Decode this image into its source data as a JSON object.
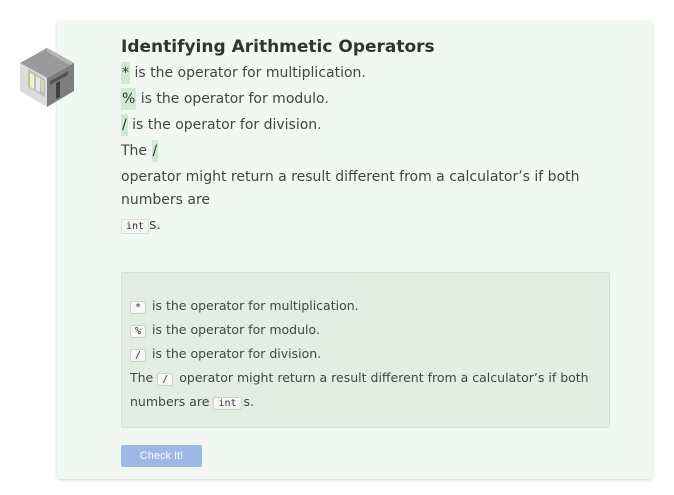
{
  "lesson": {
    "title": "Identifying Arithmetic Operators",
    "lines": [
      {
        "op": "*",
        "text": " is the operator for multiplication."
      },
      {
        "op": "%",
        "text": " is the operator for modulo."
      },
      {
        "op": "/",
        "text": " is the operator for division."
      }
    ],
    "sentence_start": "The ",
    "sentence_op": "/",
    "sentence_mid": " operator might return a result different from a calculator’s if both numbers are",
    "sentence_code": "int",
    "sentence_end": "s."
  },
  "answer": {
    "lines": [
      {
        "op": "*",
        "text": " is the operator for multiplication."
      },
      {
        "op": "%",
        "text": " is the operator for modulo."
      },
      {
        "op": "/",
        "text": " is the operator for division."
      }
    ],
    "sentence_start": "The ",
    "sentence_op": "/",
    "sentence_mid": " operator might return a result different from a calculator’s if both numbers are ",
    "sentence_code": "int",
    "sentence_end": "s."
  },
  "check_button_label": "Check It!",
  "colors": {
    "card_bg": "#f1f7f1",
    "highlight": "#cfead2",
    "answer_bg": "#e3ede3",
    "button_bg": "#9db8e6"
  },
  "icons": [
    "isometric-terminal-icon"
  ]
}
